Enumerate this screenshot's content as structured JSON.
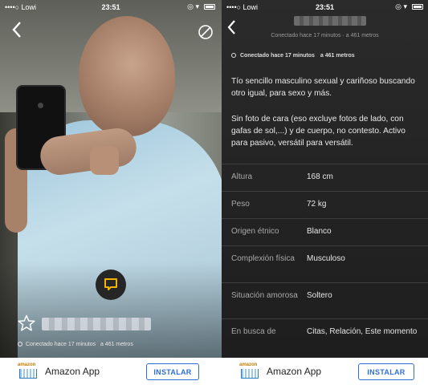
{
  "left": {
    "status_bar": {
      "carrier": "••••○ Lowi",
      "time": "23:51"
    },
    "connection": {
      "status": "Conectado hace 17 minutos",
      "distance": "a 461 metros"
    },
    "ad": {
      "title": "Amazon App",
      "logo_text": "amazon",
      "cta": "INSTALAR"
    },
    "icons": {
      "back": "chevron-left",
      "block": "prohibited-circle",
      "chat": "chat-bubble",
      "favorite": "star-outline"
    }
  },
  "right": {
    "status_bar": {
      "carrier": "••••○ Lowi",
      "time": "23:51"
    },
    "header": {
      "subtitle": "Conectado hace 17 minutos · a 461 metros"
    },
    "connection": {
      "status": "Conectado hace 17 minutos",
      "distance": "a 461 metros"
    },
    "bio": [
      "Tío sencillo masculino sexual y cariñoso buscando otro igual, para sexo y más.",
      "Sin foto de cara (eso excluye fotos de lado, con gafas de sol,...) y de cuerpo, no contesto. Activo para pasivo, versátil para versátil."
    ],
    "details": [
      {
        "label": "Altura",
        "value": "168 cm"
      },
      {
        "label": "Peso",
        "value": "72 kg"
      },
      {
        "label": "Origen étnico",
        "value": "Blanco"
      },
      {
        "label": "Complexión física",
        "value": "Musculoso"
      },
      {
        "label": "Situación amorosa",
        "value": "Soltero"
      },
      {
        "label": "En busca de",
        "value": "Citas, Relación, Este momento"
      }
    ],
    "ad": {
      "title": "Amazon App",
      "logo_text": "amazon",
      "cta": "INSTALAR"
    }
  },
  "colors": {
    "accent": "#f2b400",
    "ad_button": "#2f6fd3",
    "panel_bg": "#262626"
  }
}
